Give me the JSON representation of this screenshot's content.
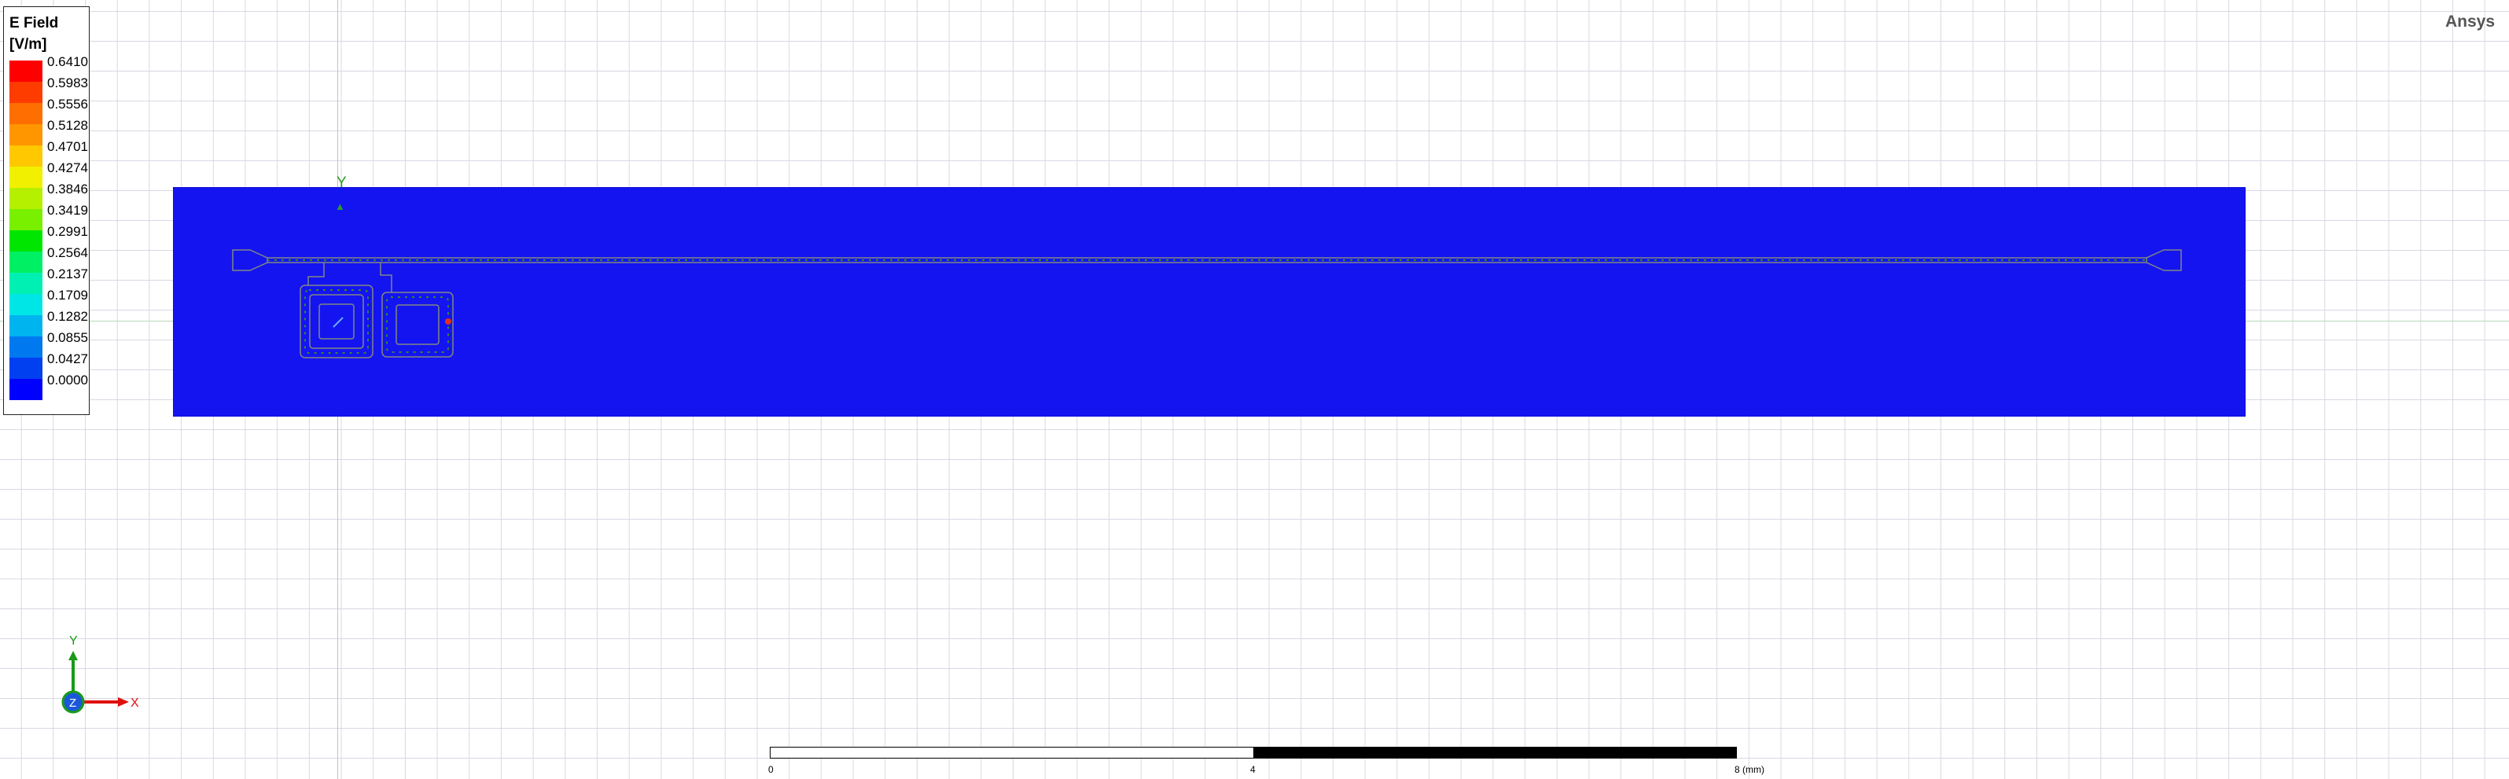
{
  "brand": "Ansys",
  "legend": {
    "title": "E Field",
    "unit": "[V/m]",
    "ticks": [
      "0.6410",
      "0.5983",
      "0.5556",
      "0.5128",
      "0.4701",
      "0.4274",
      "0.3846",
      "0.3419",
      "0.2991",
      "0.2564",
      "0.2137",
      "0.1709",
      "0.1282",
      "0.0855",
      "0.0427",
      "0.0000"
    ],
    "colors": [
      "#ff0000",
      "#ff3c00",
      "#ff6e00",
      "#ff9600",
      "#ffc800",
      "#f0f000",
      "#b4f000",
      "#78f000",
      "#00e600",
      "#00f064",
      "#00f0b4",
      "#00e6e6",
      "#00b4f0",
      "#0078f0",
      "#0040f0",
      "#0000ff"
    ]
  },
  "axes": {
    "y_label": "Y",
    "triad": {
      "x": "X",
      "y": "Y",
      "z": "Z"
    }
  },
  "scalebar": {
    "labels": [
      "0",
      "4",
      "8 (mm)"
    ]
  },
  "colors": {
    "substrate": "#1414f0",
    "trace": "#7a8a7a",
    "port": "#e03020"
  }
}
